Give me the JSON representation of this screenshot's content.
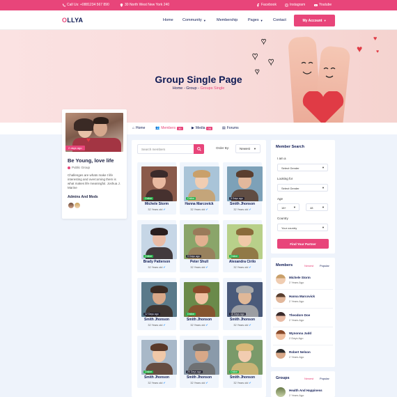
{
  "topbar": {
    "phone": "Call Us: +0881234 567 890",
    "address": "30 North West New York 240",
    "facebook": "Facebook",
    "instagram": "Instagram",
    "youtube": "Youtube"
  },
  "brand": {
    "logo_o": "O",
    "logo_rest": "LLYA"
  },
  "nav": {
    "home": "Home",
    "community": "Community",
    "membership": "Membership",
    "pages": "Pages",
    "contact": "Contact",
    "account": "My Account"
  },
  "hero": {
    "title": "Group Single Page",
    "crumb_home": "Home",
    "crumb_group": "Group",
    "crumb_current": "Groups Single",
    "sep": " - "
  },
  "group": {
    "badge": "2 days ago",
    "title": "Be Young, love life",
    "privacy": "Public Group",
    "description": "Challenges are whats make t life interesting and overcoming them is what makes life meaningful. Joshua J. Marine",
    "admins_title": "Admins And Mods"
  },
  "tabs": {
    "home": "Home",
    "members": "Members",
    "members_count": "30",
    "media": "Media",
    "media_count": "06",
    "forums": "Forums"
  },
  "controls": {
    "search_placeholder": "Search members",
    "order_label": "Order By:",
    "order_value": "Newest"
  },
  "members": [
    {
      "name": "Michele Storm",
      "age": "32 Years old",
      "status": "Online"
    },
    {
      "name": "Hanna Marcovick",
      "age": "32 Years old",
      "status": "Online"
    },
    {
      "name": "Smith Jhonson",
      "age": "32 Years old",
      "status": "3 Days ago"
    },
    {
      "name": "Brady Patterson",
      "age": "32 Years old",
      "status": "Online"
    },
    {
      "name": "Peter Shull",
      "age": "32 Years old",
      "status": "9 Days ago"
    },
    {
      "name": "Alexandra Cirilo",
      "age": "32 Years old",
      "status": "Online"
    },
    {
      "name": "Smith Jhonson",
      "age": "32 Years old",
      "status": "12 Days ago"
    },
    {
      "name": "Smith Jhonson",
      "age": "32 Years old",
      "status": "Online"
    },
    {
      "name": "Smith Jhonson",
      "age": "32 Years old",
      "status": "18 Days ago"
    },
    {
      "name": "Smith Jhonson",
      "age": "32 Years old",
      "status": "Online"
    },
    {
      "name": "Smith Jhonson",
      "age": "32 Years old",
      "status": "20 Days ago"
    },
    {
      "name": "Smith Jhonson",
      "age": "32 Years old",
      "status": "Online"
    }
  ],
  "member_search": {
    "title": "Member Search",
    "iam_label": "I am a",
    "iam_value": "Select Gender",
    "looking_label": "Looking for",
    "looking_value": "Select Gender",
    "age_label": "Age",
    "age_from": "18+",
    "age_to": "48",
    "country_label": "Country",
    "country_value": "Your country",
    "button": "Find Your Partner"
  },
  "side_members": {
    "title": "Members",
    "tab_newest": "Newest",
    "tab_popular": "Popular",
    "items": [
      {
        "name": "Michele Storm",
        "time": "2 Years Ago"
      },
      {
        "name": "Hanna Marcovick",
        "time": "2 Years Ago"
      },
      {
        "name": "Theodore Doe",
        "time": "2 Years Ago"
      },
      {
        "name": "Wynonna Judd",
        "time": "2 Days Ago"
      },
      {
        "name": "Robert Nelson",
        "time": "2 Years Ago"
      }
    ]
  },
  "side_groups": {
    "title": "Groups",
    "tab_newest": "Newest",
    "tab_popular": "Popular",
    "first_item": "Health And Happiness",
    "first_time": "2 Years Ago"
  },
  "colors": {
    "accent": "#e8457a",
    "navy": "#0e1a54",
    "online": "#28b24b"
  }
}
